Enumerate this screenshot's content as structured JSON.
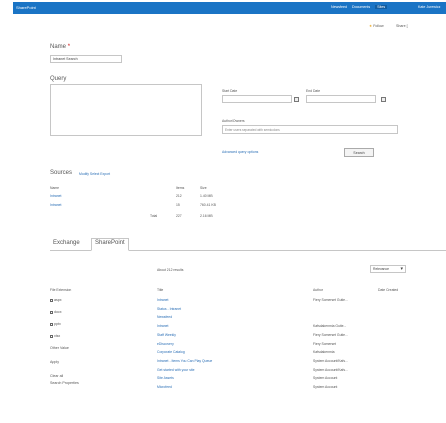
{
  "topbar": {
    "brand": "SharePoint",
    "nav": [
      "Newsfeed",
      "Documents",
      "Sites"
    ],
    "user": "Kate Jurewicz",
    "colors": {
      "bar": "#1a74c5",
      "selected": "#125ea3"
    }
  },
  "actionbar": {
    "follow": "Follow",
    "share": "Share",
    "icon": "star-icon"
  },
  "form": {
    "name_label": "Name",
    "name_required": "*",
    "name_value": "Intranet Search",
    "query_label": "Query",
    "start_date_label": "Start Date",
    "end_date_label": "End Date",
    "authors_label": "Author/Owners",
    "authors_placeholder": "Enter users separated with semicolons",
    "advanced_link": "Advanced query options",
    "search_button": "Search"
  },
  "sources": {
    "heading": "Sources",
    "links": "Modify  Select  Export",
    "headers": [
      "Name",
      "Items",
      "Size"
    ],
    "rows": [
      {
        "name": "Intranet",
        "items": "212",
        "size": "1.40 MB"
      },
      {
        "name": "Intranet",
        "items": "15",
        "size": "760.41 KB"
      }
    ],
    "total_label": "Total",
    "total_items": "227",
    "total_size": "2.16 MB"
  },
  "tabs": [
    "Exchange",
    "SharePoint"
  ],
  "results": {
    "count": "About 212 results",
    "sort_value": "Relevance",
    "col_title": "Title",
    "col_author": "Author",
    "col_date": "Date Created",
    "file_ext_label": "File Extension",
    "refiners": [
      "aspx",
      "docx",
      "pptx",
      "xlsx"
    ],
    "refiner_links": [
      "Other Value",
      "Apply",
      "Clear all",
      "Search Properties"
    ],
    "items": [
      {
        "title": "Intranet",
        "author": "Fiery Somerset Gutie..."
      },
      {
        "title": "Status - Intranet",
        "author": ""
      },
      {
        "title": "Newsfeed",
        "author": ""
      },
      {
        "title": "Intranet",
        "author": "Kafsdakenmia Gutie..."
      },
      {
        "title": "Staff Weekly",
        "author": "Fiery Somerset Gutie..."
      },
      {
        "title": "eDiscovery",
        "author": "Fiery Somerset"
      },
      {
        "title": "Corporate Catalog",
        "author": "Kafsdakenmia"
      },
      {
        "title": "Intranet - Items You Can Play Queue",
        "author": "System Account/Kafs..."
      },
      {
        "title": "Get started with your site",
        "author": "System Account/Kafs..."
      },
      {
        "title": "Site Assets",
        "author": "System Account"
      },
      {
        "title": "Microfeed",
        "author": "System Account"
      }
    ]
  }
}
